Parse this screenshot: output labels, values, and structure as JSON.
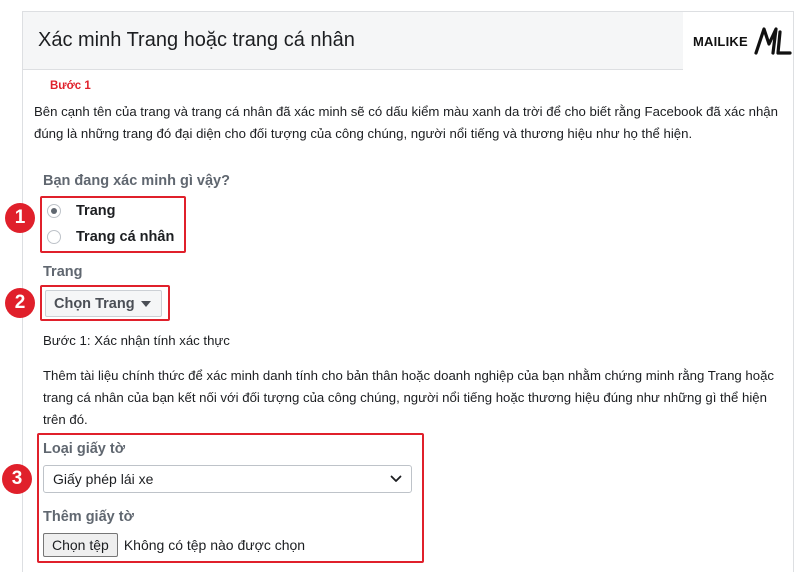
{
  "header": {
    "title": "Xác minh Trang hoặc trang cá nhân",
    "logo_text": "MAILIKE",
    "logo_icon": "ml-monogram-icon"
  },
  "step_marker": "Bước 1",
  "intro": "Bên cạnh tên của trang và trang cá nhân đã xác minh sẽ có dấu kiểm màu xanh da trời để cho biết rằng Facebook đã xác nhận đúng là những trang đó đại diện cho đối tượng của công chúng, người nổi tiếng và thương hiệu như họ thể hiện.",
  "question": {
    "title": "Bạn đang xác minh gì vậy?",
    "options": [
      {
        "label": "Trang",
        "checked": true
      },
      {
        "label": "Trang cá nhân",
        "checked": false
      }
    ]
  },
  "page_section": {
    "label": "Trang",
    "choose_button": "Chọn Trang"
  },
  "verify_step": {
    "title": "Bước 1: Xác nhận tính xác thực",
    "description": "Thêm tài liệu chính thức để xác minh danh tính cho bản thân hoặc doanh nghiệp của bạn nhằm chứng minh rằng Trang hoặc trang cá nhân của bạn kết nối với đối tượng của công chúng, người nổi tiếng hoặc thương hiệu đúng như những gì thể hiện trên đó."
  },
  "document": {
    "type_label": "Loại giấy tờ",
    "type_value": "Giấy phép lái xe",
    "add_label": "Thêm giấy tờ",
    "file_button": "Chọn tệp",
    "file_status": "Không có tệp nào được chọn"
  },
  "badges": [
    "1",
    "2",
    "3"
  ],
  "colors": {
    "highlight": "#e0202b",
    "header_bg": "#f5f6f7",
    "muted_text": "#606770"
  }
}
